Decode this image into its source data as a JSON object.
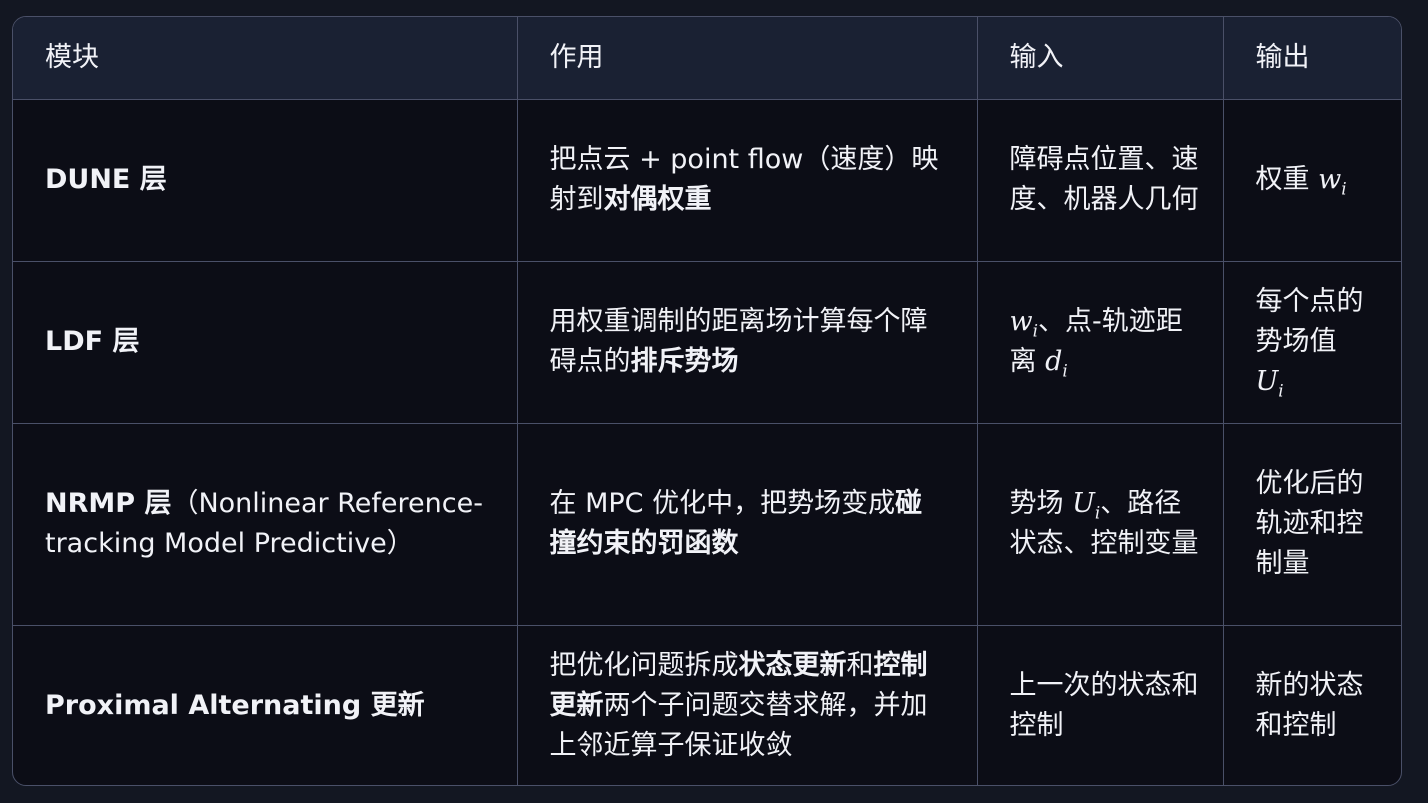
{
  "table": {
    "headers": [
      "模块",
      "作用",
      "输入",
      "输出"
    ],
    "rows": [
      {
        "module": "DUNE 层",
        "role_pre": "把点云 + point flow（速度）映射到",
        "role_bold": "对偶权重",
        "input": "障碍点位置、速度、机器人几何",
        "output_text": "权重 ",
        "output_var": "w",
        "output_sub": "i"
      },
      {
        "module": "LDF 层",
        "role_pre": "用权重调制的距离场计算每个障碍点的",
        "role_bold": "排斥势场",
        "input_var": "w",
        "input_sub": "i",
        "input_text": "、点-轨迹距离 ",
        "input_var2": "d",
        "input_sub2": "i",
        "output_text": "每个点的势场值 ",
        "output_var": "U",
        "output_sub": "i"
      },
      {
        "module": "NRMP 层",
        "module_rest": "（Nonlinear Reference-tracking Model Predictive）",
        "role_pre": "在 MPC 优化中，把势场变成",
        "role_bold": "碰撞约束的罚函数",
        "input_pre": "势场 ",
        "input_var": "U",
        "input_sub": "i",
        "input_post": "、路径状态、控制变量",
        "output": "优化后的轨迹和控制量"
      },
      {
        "module": "Proximal Alternating 更新",
        "role_pre": "把优化问题拆成",
        "role_bold1": "状态更新",
        "role_mid": "和",
        "role_bold2": "控制更新",
        "role_post": "两个子问题交替求解，并加上邻近算子保证收敛",
        "input": "上一次的状态和控制",
        "output": "新的状态和控制"
      }
    ]
  }
}
